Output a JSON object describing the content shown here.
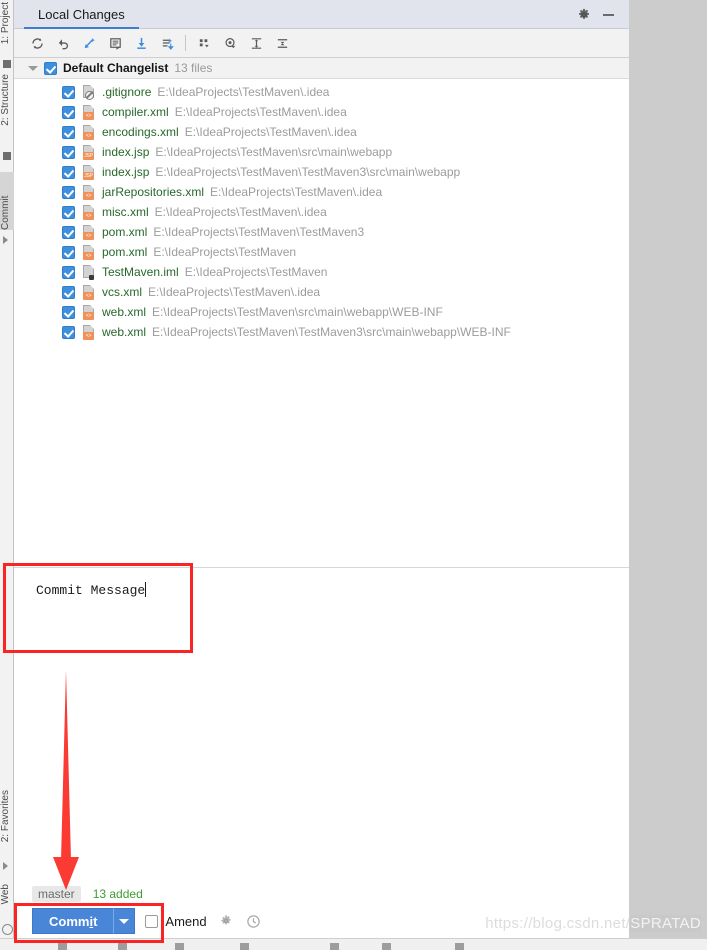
{
  "window": {
    "tab_label": "Local Changes",
    "gear_icon": "gear-icon",
    "minimize_icon": "minimize-icon"
  },
  "rail": {
    "top_items": [
      {
        "label": "1: Project"
      },
      {
        "label": "2: Structure"
      }
    ],
    "selected_item": {
      "label": "Commit"
    },
    "bottom_items": [
      {
        "label": "2: Favorites"
      },
      {
        "label": "Web"
      }
    ]
  },
  "toolbar": {
    "buttons": [
      {
        "name": "refresh-icon",
        "title": "Refresh"
      },
      {
        "name": "rollback-icon",
        "title": "Rollback"
      },
      {
        "name": "show-diff-icon",
        "title": "Show Diff"
      },
      {
        "name": "annotate-icon",
        "title": "Annotate"
      },
      {
        "name": "update-icon",
        "title": "Update Project"
      },
      {
        "name": "shelve-icon",
        "title": "Shelve Changes"
      },
      {
        "name": "group-by-icon",
        "title": "Group By"
      },
      {
        "name": "preview-diff-icon",
        "title": "Preview Diff"
      },
      {
        "name": "expand-all-icon",
        "title": "Expand All"
      },
      {
        "name": "collapse-all-icon",
        "title": "Collapse All"
      }
    ]
  },
  "changelist": {
    "name": "Default Changelist",
    "count_label": "13 files",
    "checked": true,
    "expanded": true
  },
  "files": [
    {
      "name": ".gitignore",
      "path": "E:\\IdeaProjects\\TestMaven\\.idea",
      "icon": "file-ignored-icon",
      "badge": "",
      "checked": true
    },
    {
      "name": "compiler.xml",
      "path": "E:\\IdeaProjects\\TestMaven\\.idea",
      "icon": "file-xml-icon",
      "badge": "<>",
      "checked": true
    },
    {
      "name": "encodings.xml",
      "path": "E:\\IdeaProjects\\TestMaven\\.idea",
      "icon": "file-xml-icon",
      "badge": "<>",
      "checked": true
    },
    {
      "name": "index.jsp",
      "path": "E:\\IdeaProjects\\TestMaven\\src\\main\\webapp",
      "icon": "file-jsp-icon",
      "badge": "JSP",
      "checked": true
    },
    {
      "name": "index.jsp",
      "path": "E:\\IdeaProjects\\TestMaven\\TestMaven3\\src\\main\\webapp",
      "icon": "file-jsp-icon",
      "badge": "JSP",
      "checked": true
    },
    {
      "name": "jarRepositories.xml",
      "path": "E:\\IdeaProjects\\TestMaven\\.idea",
      "icon": "file-xml-icon",
      "badge": "<>",
      "checked": true
    },
    {
      "name": "misc.xml",
      "path": "E:\\IdeaProjects\\TestMaven\\.idea",
      "icon": "file-xml-icon",
      "badge": "<>",
      "checked": true
    },
    {
      "name": "pom.xml",
      "path": "E:\\IdeaProjects\\TestMaven\\TestMaven3",
      "icon": "file-xml-icon",
      "badge": "<>",
      "checked": true
    },
    {
      "name": "pom.xml",
      "path": "E:\\IdeaProjects\\TestMaven",
      "icon": "file-xml-icon",
      "badge": "<>",
      "checked": true
    },
    {
      "name": "TestMaven.iml",
      "path": "E:\\IdeaProjects\\TestMaven",
      "icon": "file-iml-icon",
      "badge": "",
      "checked": true
    },
    {
      "name": "vcs.xml",
      "path": "E:\\IdeaProjects\\TestMaven\\.idea",
      "icon": "file-xml-icon",
      "badge": "<>",
      "checked": true
    },
    {
      "name": "web.xml",
      "path": "E:\\IdeaProjects\\TestMaven\\src\\main\\webapp\\WEB-INF",
      "icon": "file-xml-icon",
      "badge": "<>",
      "checked": true
    },
    {
      "name": "web.xml",
      "path": "E:\\IdeaProjects\\TestMaven\\TestMaven3\\src\\main\\webapp\\WEB-INF",
      "icon": "file-xml-icon",
      "badge": "<>",
      "checked": true
    }
  ],
  "commit_message": {
    "value": "Commit Message",
    "placeholder": "Commit Message"
  },
  "bottom": {
    "branch": "master",
    "added_label": "13 added",
    "commit_button": "Commit",
    "commit_button_prefix": "Comm",
    "commit_button_accel": "i",
    "commit_button_suffix": "t",
    "amend_label": "Amend",
    "amend_checked": false,
    "settings_icon": "gear-icon",
    "history_icon": "clock-icon"
  },
  "watermark": {
    "text_plain": "https://blog.csdn.net/",
    "text_highlight": "SPRATAD"
  },
  "colors": {
    "accent_blue": "#4a86d8",
    "tab_underline": "#3d7dcc",
    "file_name_green": "#27682a",
    "file_path_gray": "#9c9c9c",
    "added_green": "#3f9c35",
    "annotation_red": "#fb2424",
    "header_bg": "#e1e4ec",
    "toolbar_bg": "#f2f2f2",
    "badge_orange": "#f0915a"
  }
}
